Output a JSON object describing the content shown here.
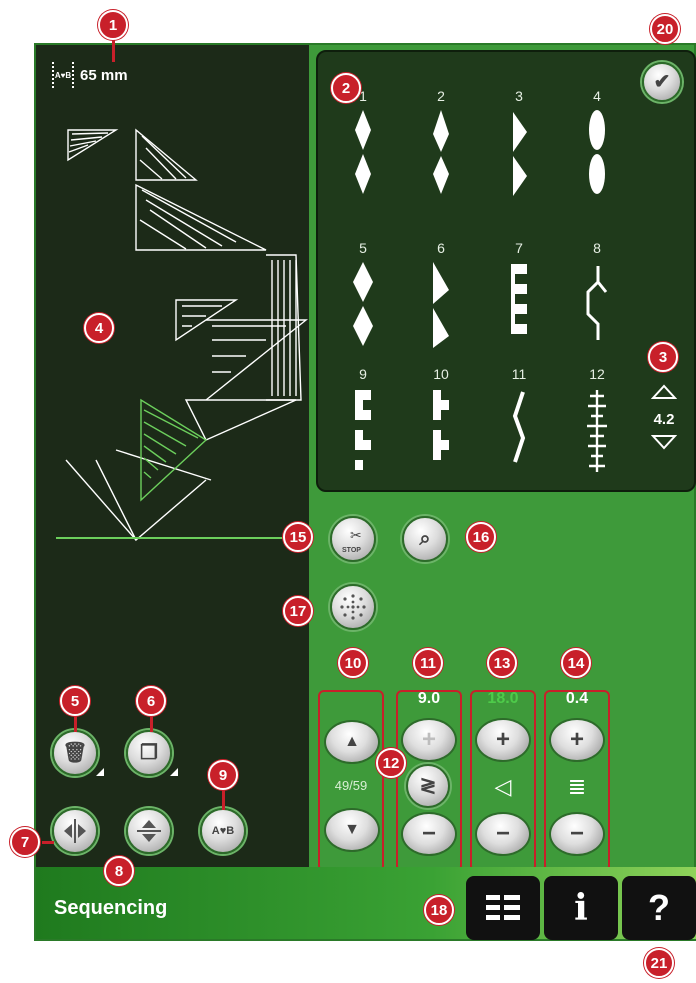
{
  "header": {
    "size_value": "65 mm",
    "size_icon_text": "A♥B"
  },
  "stitch_menu": {
    "stitches": [
      {
        "num": "1"
      },
      {
        "num": "2"
      },
      {
        "num": "3"
      },
      {
        "num": "4"
      },
      {
        "num": "5"
      },
      {
        "num": "6"
      },
      {
        "num": "7"
      },
      {
        "num": "8"
      },
      {
        "num": "9"
      },
      {
        "num": "10"
      },
      {
        "num": "11"
      },
      {
        "num": "12"
      }
    ],
    "scroll_value": "4.2"
  },
  "controls": {
    "stitch_position": "49/59",
    "stitch_width": "9.0",
    "stitch_length_dim": "18.0",
    "stitch_density": "0.4"
  },
  "icons": {
    "alphabet_text": "A♥B",
    "stop_text": "STOP"
  },
  "bottom": {
    "title": "Sequencing"
  },
  "callouts": [
    "1",
    "2",
    "3",
    "4",
    "5",
    "6",
    "7",
    "8",
    "9",
    "10",
    "11",
    "12",
    "13",
    "14",
    "15",
    "16",
    "17",
    "18",
    "20",
    "21"
  ],
  "colors": {
    "accent_red": "#c8202a",
    "panel_green": "#3e9a3a",
    "dark": "#1c2a18"
  }
}
